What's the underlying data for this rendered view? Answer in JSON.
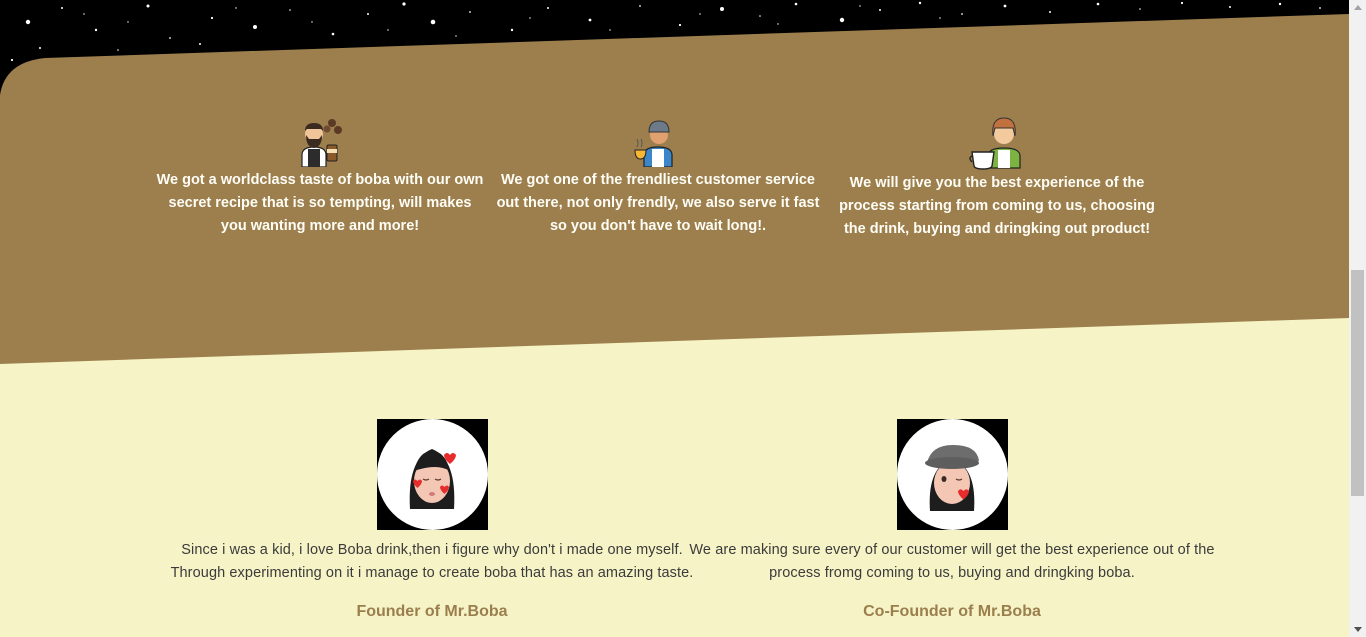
{
  "colors": {
    "band": "#9d7f4e",
    "cream": "#f6f4c6",
    "accent": "#9b7e4d"
  },
  "features": [
    {
      "icon": "barista-man-icon",
      "text": "We got a worldclass taste of boba with our own secret recipe that is so tempting, will makes you wanting more and more!"
    },
    {
      "icon": "waiter-icon",
      "text": "We got one of the frendliest customer service out there, not only frendly, we also serve it fast so you don't have to wait long!."
    },
    {
      "icon": "barista-woman-icon",
      "text": "We will give you the best experience of the process starting from coming to us, choosing the drink, buying and dringking out product!"
    }
  ],
  "team": [
    {
      "avatar": "founder-memoji-avatar",
      "quote": "Since i was a kid, i love Boba drink,then i figure why don't i made one myself. Through experimenting on it i manage to create boba that has an amazing taste.",
      "role": "Founder of Mr.Boba"
    },
    {
      "avatar": "cofounder-memoji-avatar",
      "quote": "We are making sure every of our customer will get the best experience out of the process fromg coming to us, buying and dringking boba.",
      "role": "Co-Founder of Mr.Boba"
    }
  ]
}
